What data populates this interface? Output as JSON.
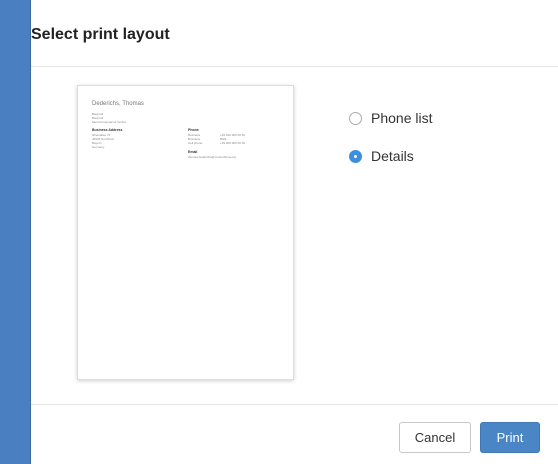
{
  "dialog": {
    "title": "Select print layout"
  },
  "preview": {
    "contact_name": "Dederichs, Thomas",
    "top_lines": [
      "Bauprofi",
      "Bauprofi",
      "Mein-Firmenname GmbH"
    ],
    "business_address": {
      "heading": "Business Address",
      "lines": [
        "Rheinallee 70",
        "40545 Nordrhein",
        "Bayern",
        "Germany"
      ]
    },
    "phone": {
      "heading": "Phone",
      "rows": [
        {
          "label": "Business",
          "value": "+49 000 000 00 50"
        },
        {
          "label": "Business",
          "value": "8001"
        },
        {
          "label": "Cell phone",
          "value": "+49 000 000 00 00"
        }
      ]
    },
    "email": {
      "heading": "Email",
      "value": "thomas.dederichs@musterfirma.org"
    }
  },
  "layout_options": [
    {
      "label": "Phone list",
      "checked": false
    },
    {
      "label": "Details",
      "checked": true
    }
  ],
  "buttons": {
    "cancel": "Cancel",
    "print": "Print"
  },
  "colors": {
    "frame": "#4a7fc1",
    "accent": "#3c8fe0",
    "primary_button": "#4a86c5"
  }
}
